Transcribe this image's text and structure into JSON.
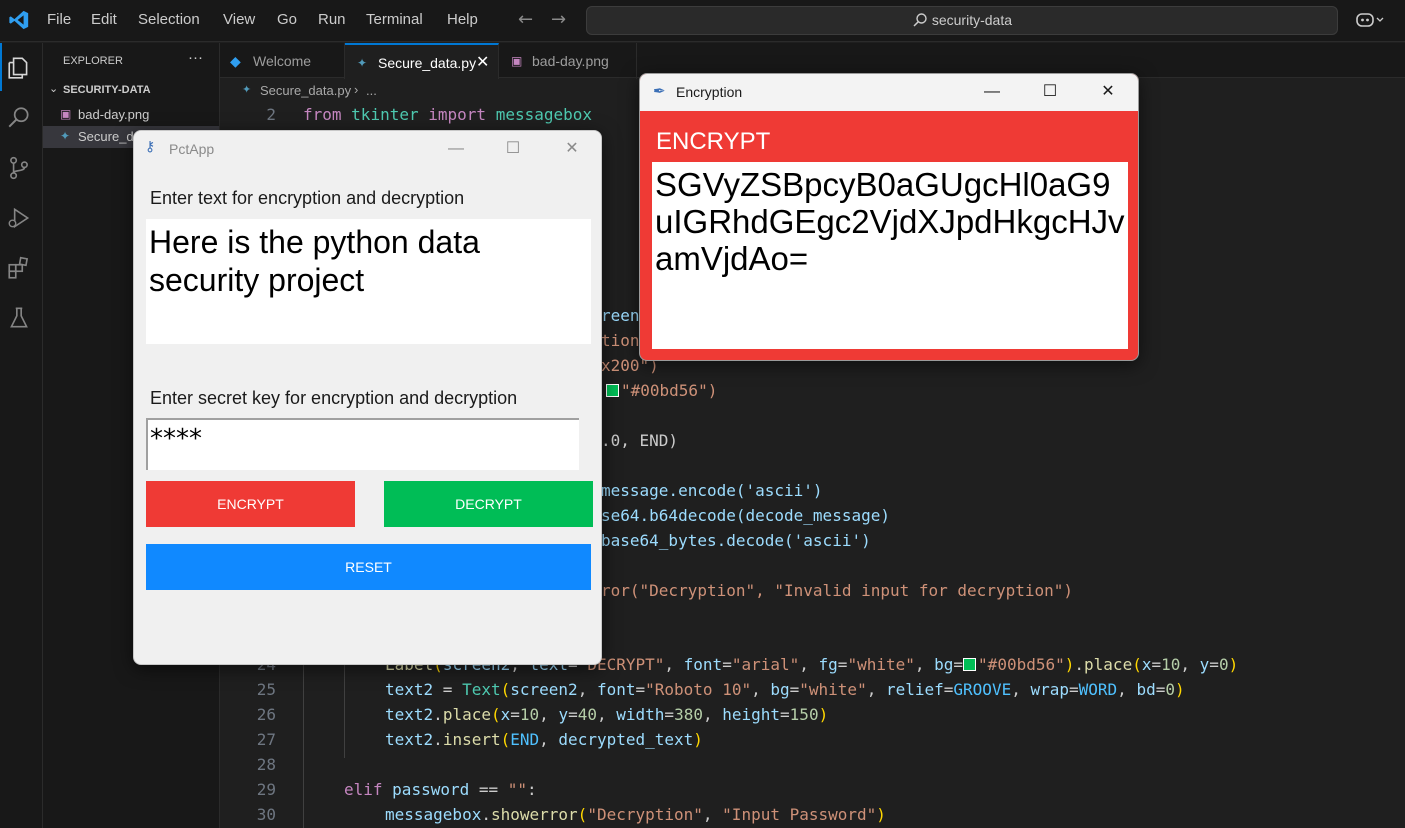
{
  "titlebar": {
    "menus": [
      "File",
      "Edit",
      "Selection",
      "View",
      "Go",
      "Run",
      "Terminal",
      "Help"
    ],
    "search": "security-data"
  },
  "sidebar": {
    "title": "EXPLORER",
    "folder": "SECURITY-DATA",
    "files": [
      {
        "name": "bad-day.png",
        "icon": "image-file-icon"
      },
      {
        "name": "Secure_data.py",
        "icon": "python-file-icon"
      }
    ]
  },
  "tabs": [
    {
      "label": "Welcome",
      "icon": "vscode-logo-icon"
    },
    {
      "label": "Secure_data.py",
      "icon": "python-file-icon",
      "active": true
    },
    {
      "label": "bad-day.png",
      "icon": "image-file-icon"
    }
  ],
  "breadcrumb": {
    "file": "Secure_data.py",
    "more": "..."
  },
  "code": {
    "line2": {
      "num": "2",
      "kw": "from",
      "mod": "tkinter",
      "kw2": "import",
      "name": "messagebox"
    },
    "line24": {
      "num": "24"
    },
    "line25": {
      "num": "25"
    },
    "line26": {
      "num": "26"
    },
    "line27": {
      "num": "27"
    },
    "line28": {
      "num": "28"
    },
    "line29": {
      "num": "29"
    },
    "line30": {
      "num": "30"
    },
    "frag_reen": "reen",
    "frag_tion": "tion",
    "frag_x200": "x200\")",
    "frag_color": "\"#00bd56\")",
    "frag_end": ".0, END)",
    "frag_encode": "message.encode('ascii')",
    "frag_b64": "se64.b64decode(decode_message)",
    "frag_bytes": "base64_bytes.decode('ascii')",
    "frag_err": "ror(\"Decryption\", \"Invalid input for decryption\")",
    "green": "#00bd56"
  },
  "pctapp": {
    "title": "PctApp",
    "label_text": "Enter text for encryption and decryption",
    "text_value": "Here is the python data security project",
    "label_key": "Enter secret key for encryption and decryption",
    "key_value": "****",
    "encrypt": "ENCRYPT",
    "decrypt": "DECRYPT",
    "reset": "RESET",
    "colors": {
      "encrypt": "#ef3a35",
      "decrypt": "#00bd56",
      "reset": "#1089ff"
    }
  },
  "encwin": {
    "title": "Encryption",
    "heading": "ENCRYPT",
    "output": "SGVyZSBpcyB0aGUgcHl0aG9uIGRhdGEgc2VjdXJpdHkgcHJvamVjdAo="
  }
}
